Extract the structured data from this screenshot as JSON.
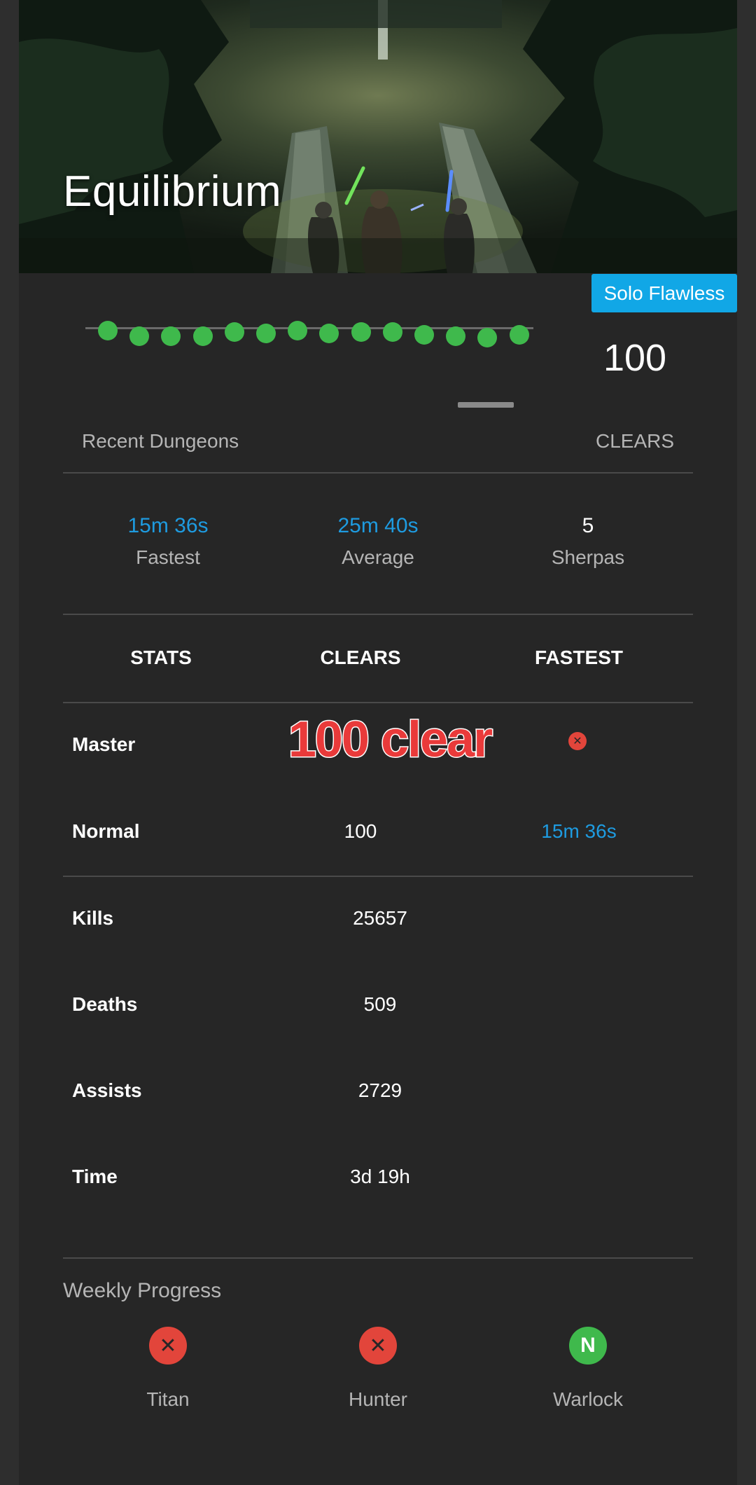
{
  "hero": {
    "title": "Equilibrium"
  },
  "badge": {
    "label": "Solo Flawless"
  },
  "recent": {
    "label": "Recent Dungeons",
    "clears_label": "CLEARS",
    "clears_value": "100",
    "dot_color": "#3fb94c",
    "dot_count": 14
  },
  "summary": [
    {
      "value": "15m 36s",
      "label": "Fastest"
    },
    {
      "value": "25m 40s",
      "label": "Average"
    },
    {
      "value": "5",
      "label": "Sherpas"
    }
  ],
  "stats_table": {
    "headers": [
      "STATS",
      "CLEARS",
      "FASTEST"
    ],
    "rows": [
      {
        "label": "Master",
        "clears": "",
        "fastest": "✕"
      },
      {
        "label": "Normal",
        "clears": "100",
        "fastest": "15m 36s"
      }
    ],
    "totals": [
      {
        "label": "Kills",
        "value": "25657"
      },
      {
        "label": "Deaths",
        "value": "509"
      },
      {
        "label": "Assists",
        "value": "2729"
      },
      {
        "label": "Time",
        "value": "3d 19h"
      }
    ]
  },
  "overlay_text": "100 clear",
  "weekly": {
    "title": "Weekly Progress",
    "classes": [
      {
        "label": "Titan",
        "status": "✕"
      },
      {
        "label": "Hunter",
        "status": "✕"
      },
      {
        "label": "Warlock",
        "status": "N"
      }
    ]
  },
  "colors": {
    "accent_blue": "#1e9be0",
    "badge_blue": "#11a7e6",
    "success_green": "#3fb94c",
    "fail_red": "#e2453b"
  }
}
